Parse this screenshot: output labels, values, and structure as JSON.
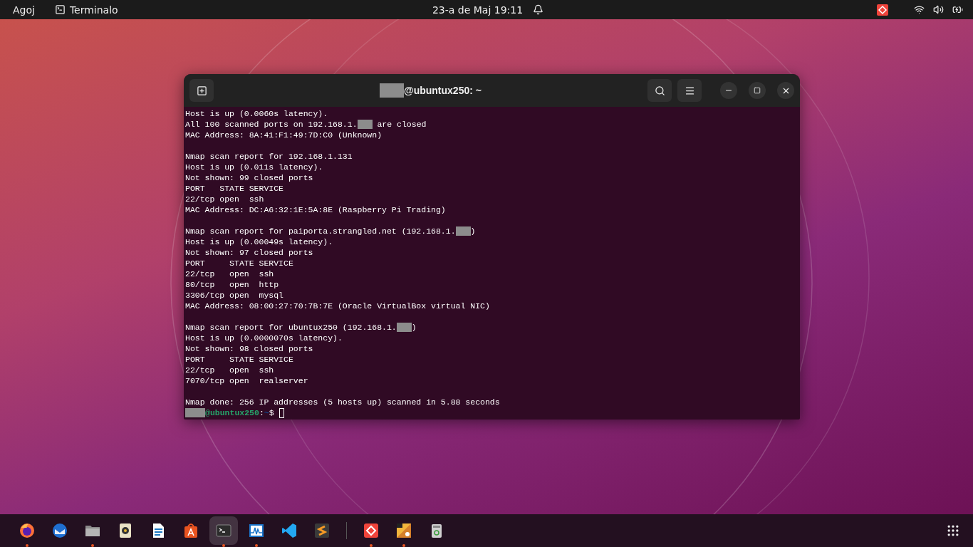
{
  "top_bar": {
    "activities": "Agoj",
    "app_name": "Terminalo",
    "clock": "23-a de Maj  19:11"
  },
  "terminal": {
    "title_suffix": "@ubuntux250: ~",
    "lines": [
      {
        "kind": "output",
        "segments": [
          {
            "kind": "text",
            "text": "Host is up (0.0060s latency)."
          }
        ]
      },
      {
        "kind": "output",
        "segments": [
          {
            "kind": "text",
            "text": "All 100 scanned ports on 192.168.1."
          },
          {
            "kind": "redacted"
          },
          {
            "kind": "text",
            "text": " are closed"
          }
        ]
      },
      {
        "kind": "output",
        "segments": [
          {
            "kind": "text",
            "text": "MAC Address: 8A:41:F1:49:7D:C0 (Unknown)"
          }
        ]
      },
      {
        "kind": "blank"
      },
      {
        "kind": "output",
        "segments": [
          {
            "kind": "text",
            "text": "Nmap scan report for 192.168.1.131"
          }
        ]
      },
      {
        "kind": "output",
        "segments": [
          {
            "kind": "text",
            "text": "Host is up (0.011s latency)."
          }
        ]
      },
      {
        "kind": "output",
        "segments": [
          {
            "kind": "text",
            "text": "Not shown: 99 closed ports"
          }
        ]
      },
      {
        "kind": "output",
        "segments": [
          {
            "kind": "text",
            "text": "PORT   STATE SERVICE"
          }
        ]
      },
      {
        "kind": "output",
        "segments": [
          {
            "kind": "text",
            "text": "22/tcp open  ssh"
          }
        ]
      },
      {
        "kind": "output",
        "segments": [
          {
            "kind": "text",
            "text": "MAC Address: DC:A6:32:1E:5A:8E (Raspberry Pi Trading)"
          }
        ]
      },
      {
        "kind": "blank"
      },
      {
        "kind": "output",
        "segments": [
          {
            "kind": "text",
            "text": "Nmap scan report for paiporta.strangled.net (192.168.1."
          },
          {
            "kind": "redacted"
          },
          {
            "kind": "text",
            "text": ")"
          }
        ]
      },
      {
        "kind": "output",
        "segments": [
          {
            "kind": "text",
            "text": "Host is up (0.00049s latency)."
          }
        ]
      },
      {
        "kind": "output",
        "segments": [
          {
            "kind": "text",
            "text": "Not shown: 97 closed ports"
          }
        ]
      },
      {
        "kind": "output",
        "segments": [
          {
            "kind": "text",
            "text": "PORT     STATE SERVICE"
          }
        ]
      },
      {
        "kind": "output",
        "segments": [
          {
            "kind": "text",
            "text": "22/tcp   open  ssh"
          }
        ]
      },
      {
        "kind": "output",
        "segments": [
          {
            "kind": "text",
            "text": "80/tcp   open  http"
          }
        ]
      },
      {
        "kind": "output",
        "segments": [
          {
            "kind": "text",
            "text": "3306/tcp open  mysql"
          }
        ]
      },
      {
        "kind": "output",
        "segments": [
          {
            "kind": "text",
            "text": "MAC Address: 08:00:27:70:7B:7E (Oracle VirtualBox virtual NIC)"
          }
        ]
      },
      {
        "kind": "blank"
      },
      {
        "kind": "output",
        "segments": [
          {
            "kind": "text",
            "text": "Nmap scan report for ubuntux250 (192.168.1."
          },
          {
            "kind": "redacted"
          },
          {
            "kind": "text",
            "text": ")"
          }
        ]
      },
      {
        "kind": "output",
        "segments": [
          {
            "kind": "text",
            "text": "Host is up (0.0000070s latency)."
          }
        ]
      },
      {
        "kind": "output",
        "segments": [
          {
            "kind": "text",
            "text": "Not shown: 98 closed ports"
          }
        ]
      },
      {
        "kind": "output",
        "segments": [
          {
            "kind": "text",
            "text": "PORT     STATE SERVICE"
          }
        ]
      },
      {
        "kind": "output",
        "segments": [
          {
            "kind": "text",
            "text": "22/tcp   open  ssh"
          }
        ]
      },
      {
        "kind": "output",
        "segments": [
          {
            "kind": "text",
            "text": "7070/tcp open  realserver"
          }
        ]
      },
      {
        "kind": "blank"
      },
      {
        "kind": "output",
        "segments": [
          {
            "kind": "text",
            "text": "Nmap done: 256 IP addresses (5 hosts up) scanned in 5.88 seconds"
          }
        ]
      },
      {
        "kind": "prompt",
        "segments": [
          {
            "kind": "redacted_user"
          },
          {
            "kind": "host",
            "text": "@ubuntux250"
          },
          {
            "kind": "text",
            "text": ":"
          },
          {
            "kind": "path",
            "text": "~"
          },
          {
            "kind": "text",
            "text": "$ "
          },
          {
            "kind": "cursor"
          }
        ]
      }
    ]
  },
  "dock": [
    {
      "kind": "browser",
      "running": true,
      "active": false
    },
    {
      "kind": "mail",
      "running": false,
      "active": false
    },
    {
      "kind": "files",
      "running": true,
      "active": false
    },
    {
      "kind": "music",
      "running": false,
      "active": false
    },
    {
      "kind": "writer",
      "running": false,
      "active": false
    },
    {
      "kind": "store",
      "running": false,
      "active": false
    },
    {
      "kind": "terminal",
      "running": true,
      "active": true
    },
    {
      "kind": "monitor",
      "running": true,
      "active": false
    },
    {
      "kind": "code",
      "running": false,
      "active": false
    },
    {
      "kind": "editor",
      "running": false,
      "active": false
    },
    {
      "kind": "separator"
    },
    {
      "kind": "remote",
      "running": true,
      "active": false
    },
    {
      "kind": "paint",
      "running": true,
      "active": false
    },
    {
      "kind": "trash",
      "running": false,
      "active": false
    }
  ]
}
